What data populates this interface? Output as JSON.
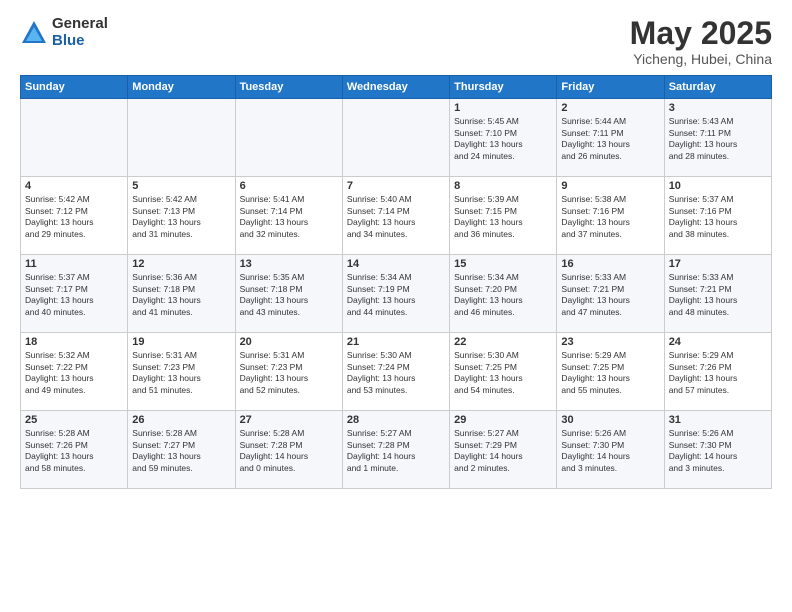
{
  "logo": {
    "general": "General",
    "blue": "Blue"
  },
  "title": "May 2025",
  "subtitle": "Yicheng, Hubei, China",
  "days_of_week": [
    "Sunday",
    "Monday",
    "Tuesday",
    "Wednesday",
    "Thursday",
    "Friday",
    "Saturday"
  ],
  "weeks": [
    [
      {
        "day": "",
        "info": ""
      },
      {
        "day": "",
        "info": ""
      },
      {
        "day": "",
        "info": ""
      },
      {
        "day": "",
        "info": ""
      },
      {
        "day": "1",
        "info": "Sunrise: 5:45 AM\nSunset: 7:10 PM\nDaylight: 13 hours\nand 24 minutes."
      },
      {
        "day": "2",
        "info": "Sunrise: 5:44 AM\nSunset: 7:11 PM\nDaylight: 13 hours\nand 26 minutes."
      },
      {
        "day": "3",
        "info": "Sunrise: 5:43 AM\nSunset: 7:11 PM\nDaylight: 13 hours\nand 28 minutes."
      }
    ],
    [
      {
        "day": "4",
        "info": "Sunrise: 5:42 AM\nSunset: 7:12 PM\nDaylight: 13 hours\nand 29 minutes."
      },
      {
        "day": "5",
        "info": "Sunrise: 5:42 AM\nSunset: 7:13 PM\nDaylight: 13 hours\nand 31 minutes."
      },
      {
        "day": "6",
        "info": "Sunrise: 5:41 AM\nSunset: 7:14 PM\nDaylight: 13 hours\nand 32 minutes."
      },
      {
        "day": "7",
        "info": "Sunrise: 5:40 AM\nSunset: 7:14 PM\nDaylight: 13 hours\nand 34 minutes."
      },
      {
        "day": "8",
        "info": "Sunrise: 5:39 AM\nSunset: 7:15 PM\nDaylight: 13 hours\nand 36 minutes."
      },
      {
        "day": "9",
        "info": "Sunrise: 5:38 AM\nSunset: 7:16 PM\nDaylight: 13 hours\nand 37 minutes."
      },
      {
        "day": "10",
        "info": "Sunrise: 5:37 AM\nSunset: 7:16 PM\nDaylight: 13 hours\nand 38 minutes."
      }
    ],
    [
      {
        "day": "11",
        "info": "Sunrise: 5:37 AM\nSunset: 7:17 PM\nDaylight: 13 hours\nand 40 minutes."
      },
      {
        "day": "12",
        "info": "Sunrise: 5:36 AM\nSunset: 7:18 PM\nDaylight: 13 hours\nand 41 minutes."
      },
      {
        "day": "13",
        "info": "Sunrise: 5:35 AM\nSunset: 7:18 PM\nDaylight: 13 hours\nand 43 minutes."
      },
      {
        "day": "14",
        "info": "Sunrise: 5:34 AM\nSunset: 7:19 PM\nDaylight: 13 hours\nand 44 minutes."
      },
      {
        "day": "15",
        "info": "Sunrise: 5:34 AM\nSunset: 7:20 PM\nDaylight: 13 hours\nand 46 minutes."
      },
      {
        "day": "16",
        "info": "Sunrise: 5:33 AM\nSunset: 7:21 PM\nDaylight: 13 hours\nand 47 minutes."
      },
      {
        "day": "17",
        "info": "Sunrise: 5:33 AM\nSunset: 7:21 PM\nDaylight: 13 hours\nand 48 minutes."
      }
    ],
    [
      {
        "day": "18",
        "info": "Sunrise: 5:32 AM\nSunset: 7:22 PM\nDaylight: 13 hours\nand 49 minutes."
      },
      {
        "day": "19",
        "info": "Sunrise: 5:31 AM\nSunset: 7:23 PM\nDaylight: 13 hours\nand 51 minutes."
      },
      {
        "day": "20",
        "info": "Sunrise: 5:31 AM\nSunset: 7:23 PM\nDaylight: 13 hours\nand 52 minutes."
      },
      {
        "day": "21",
        "info": "Sunrise: 5:30 AM\nSunset: 7:24 PM\nDaylight: 13 hours\nand 53 minutes."
      },
      {
        "day": "22",
        "info": "Sunrise: 5:30 AM\nSunset: 7:25 PM\nDaylight: 13 hours\nand 54 minutes."
      },
      {
        "day": "23",
        "info": "Sunrise: 5:29 AM\nSunset: 7:25 PM\nDaylight: 13 hours\nand 55 minutes."
      },
      {
        "day": "24",
        "info": "Sunrise: 5:29 AM\nSunset: 7:26 PM\nDaylight: 13 hours\nand 57 minutes."
      }
    ],
    [
      {
        "day": "25",
        "info": "Sunrise: 5:28 AM\nSunset: 7:26 PM\nDaylight: 13 hours\nand 58 minutes."
      },
      {
        "day": "26",
        "info": "Sunrise: 5:28 AM\nSunset: 7:27 PM\nDaylight: 13 hours\nand 59 minutes."
      },
      {
        "day": "27",
        "info": "Sunrise: 5:28 AM\nSunset: 7:28 PM\nDaylight: 14 hours\nand 0 minutes."
      },
      {
        "day": "28",
        "info": "Sunrise: 5:27 AM\nSunset: 7:28 PM\nDaylight: 14 hours\nand 1 minute."
      },
      {
        "day": "29",
        "info": "Sunrise: 5:27 AM\nSunset: 7:29 PM\nDaylight: 14 hours\nand 2 minutes."
      },
      {
        "day": "30",
        "info": "Sunrise: 5:26 AM\nSunset: 7:30 PM\nDaylight: 14 hours\nand 3 minutes."
      },
      {
        "day": "31",
        "info": "Sunrise: 5:26 AM\nSunset: 7:30 PM\nDaylight: 14 hours\nand 3 minutes."
      }
    ]
  ]
}
